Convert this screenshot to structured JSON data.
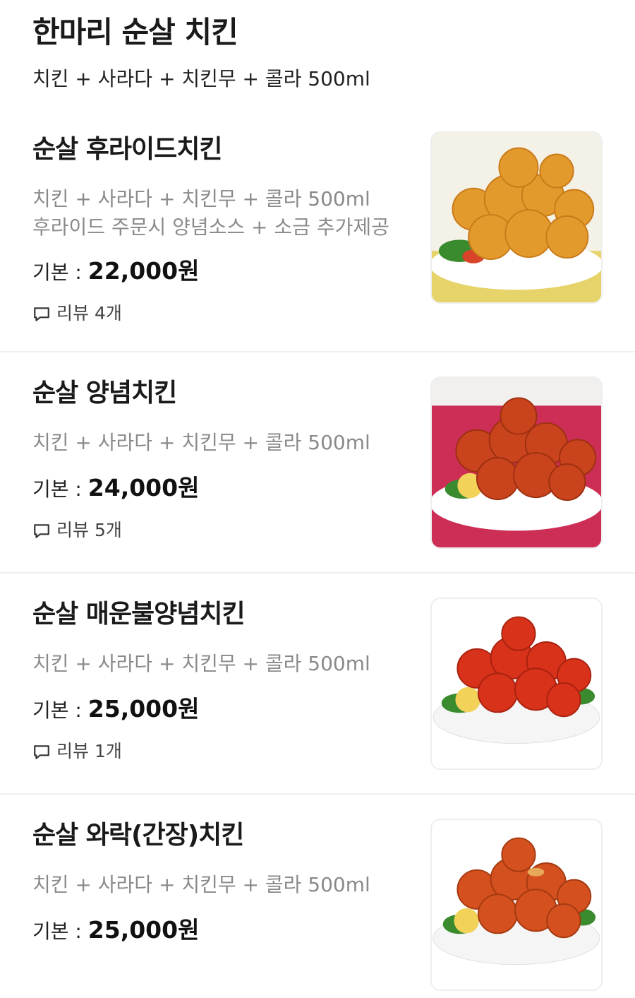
{
  "header": {
    "title": "한마리 순살 치킨",
    "subtitle": "치킨 + 사라다 + 치킨무 + 콜라 500ml"
  },
  "items": [
    {
      "name": "순살 후라이드치킨",
      "desc_lines": [
        "치킨 + 사라다 + 치킨무 +  콜라 500ml",
        "후라이드 주문시 양념소스 + 소금 추가제공"
      ],
      "price_label": "기본 : ",
      "price": "22,000원",
      "review": "리뷰 4개",
      "image": "fried-chicken-image"
    },
    {
      "name": "순살 양념치킨",
      "desc_lines": [
        "치킨 + 사라다 + 치킨무 + 콜라 500ml"
      ],
      "price_label": "기본 : ",
      "price": "24,000원",
      "review": "리뷰 5개",
      "image": "seasoned-chicken-image"
    },
    {
      "name": "순살 매운불양념치킨",
      "desc_lines": [
        "치킨 + 사라다 + 치킨무 + 콜라 500ml"
      ],
      "price_label": "기본 : ",
      "price": "25,000원",
      "review": "리뷰 1개",
      "image": "spicy-chicken-image"
    },
    {
      "name": "순살 와락(간장)치킨",
      "desc_lines": [
        "치킨 + 사라다 + 치킨무 + 콜라 500ml"
      ],
      "price_label": "기본 : ",
      "price": "25,000원",
      "image": "soy-chicken-image"
    }
  ],
  "colors": {
    "fried": "#e39a2c",
    "seasoned": "#c9441c",
    "spicy": "#d9321a",
    "soy": "#d5501f"
  }
}
